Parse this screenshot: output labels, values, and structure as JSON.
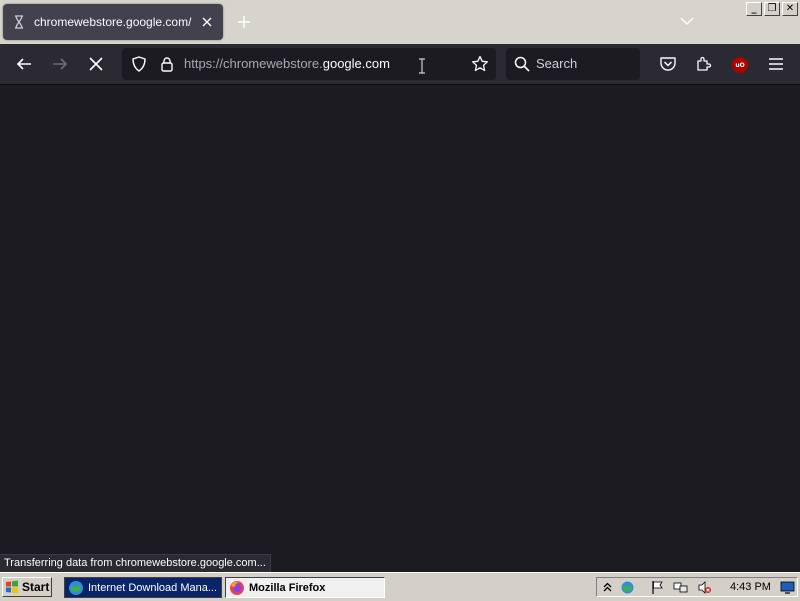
{
  "window": {
    "minimize_glyph": "_",
    "restore_glyph": "❐",
    "close_glyph": "✕"
  },
  "tab": {
    "title": "chromewebstore.google.com/",
    "favicon": "hourglass-loading-icon"
  },
  "navbar": {
    "url_prefix": "https://chromewebstore.",
    "url_host": "google.com",
    "search_placeholder": "Search",
    "extension_badge": "uO"
  },
  "status": {
    "text": "Transferring data from chromewebstore.google.com..."
  },
  "taskbar": {
    "start_label": "Start",
    "tasks": [
      {
        "label": "Internet Download Mana...",
        "icon": "idm-globe-icon"
      },
      {
        "label": "Mozilla Firefox",
        "icon": "firefox-icon"
      }
    ],
    "clock": "4:43 PM"
  },
  "colors": {
    "content_bg": "#1c1b22",
    "toolbar_bg": "#2b2a33",
    "tab_bg": "#42414d",
    "tabstrip_bg": "#d7d4cc",
    "taskbar_bg": "#d4d0c8",
    "active_task_bg": "#0a246a",
    "ublock_red": "#b00000"
  }
}
